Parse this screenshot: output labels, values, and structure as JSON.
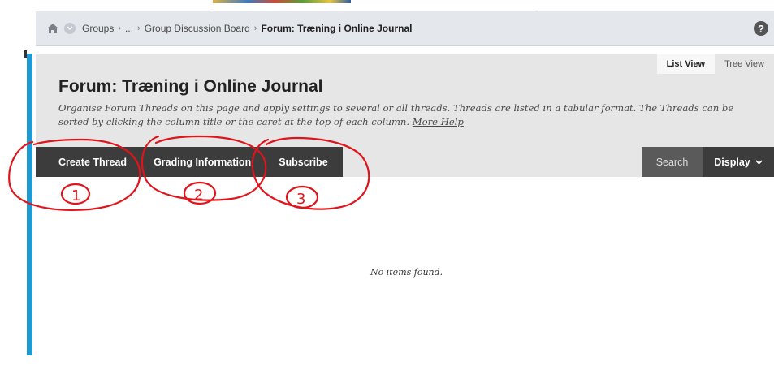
{
  "breadcrumb": {
    "items": [
      "Groups",
      "...",
      "Group Discussion Board"
    ],
    "current": "Forum: Træning i Online Journal",
    "separator": "›"
  },
  "help": {
    "label": "?"
  },
  "view_tabs": {
    "list": "List View",
    "tree": "Tree View"
  },
  "page": {
    "title": "Forum: Træning i Online Journal",
    "description": "Organise Forum Threads on this page and apply settings to several or all threads. Threads are listed in a tabular format. The Threads can be sorted by clicking the column title or the caret at the top of each column.",
    "more_help": "More Help"
  },
  "actions": {
    "create": "Create Thread",
    "grading": "Grading Information",
    "subscribe": "Subscribe"
  },
  "toolbar": {
    "search": "Search",
    "display": "Display"
  },
  "content": {
    "empty": "No items found."
  },
  "annotations": {
    "one": "1",
    "two": "2",
    "three": "3",
    "color": "#e0141b"
  },
  "colors": {
    "accent_bar": "#1f9ad1",
    "action_dark": "#3c3c3c"
  }
}
